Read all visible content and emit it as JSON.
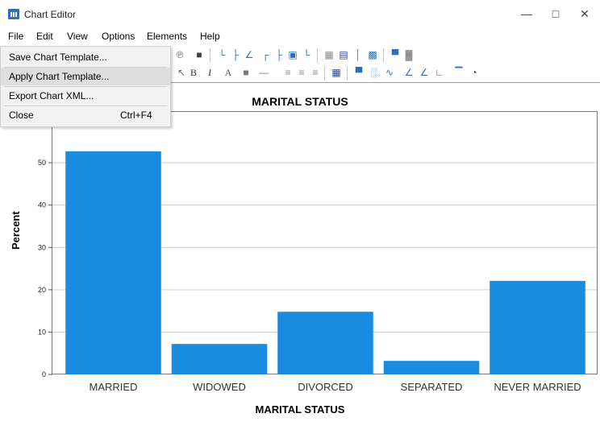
{
  "window": {
    "title": "Chart Editor",
    "controls": {
      "minimize": "—",
      "maximize": "□",
      "close": "✕"
    }
  },
  "menubar": {
    "items": [
      "File",
      "Edit",
      "View",
      "Options",
      "Elements",
      "Help"
    ]
  },
  "file_menu": {
    "items": [
      {
        "label": "Save Chart Template...",
        "shortcut": ""
      },
      {
        "label": "Apply Chart Template...",
        "shortcut": ""
      },
      {
        "label": "Export Chart XML...",
        "shortcut": ""
      },
      {
        "label": "Close",
        "shortcut": "Ctrl+F4"
      }
    ],
    "highlighted_index": 1
  },
  "toolbar": {
    "format": {
      "bold": "B",
      "italic": "I",
      "text_size": "A"
    }
  },
  "colors": {
    "bar": "#1a8ce0",
    "grid": "#cccccc",
    "frame": "#7a7a7a",
    "app_icon": "#2a6fbe"
  },
  "chart_data": {
    "type": "bar",
    "title": "MARITAL STATUS",
    "xlabel": "MARITAL STATUS",
    "ylabel": "Percent",
    "categories": [
      "MARRIED",
      "WIDOWED",
      "DIVORCED",
      "SEPARATED",
      "NEVER MARRIED"
    ],
    "values": [
      52.7,
      7.2,
      14.8,
      3.2,
      22.1
    ],
    "yticks": [
      0,
      10,
      20,
      30,
      40,
      50
    ],
    "ylim": [
      0,
      62
    ],
    "grid": true,
    "legend": "none"
  }
}
